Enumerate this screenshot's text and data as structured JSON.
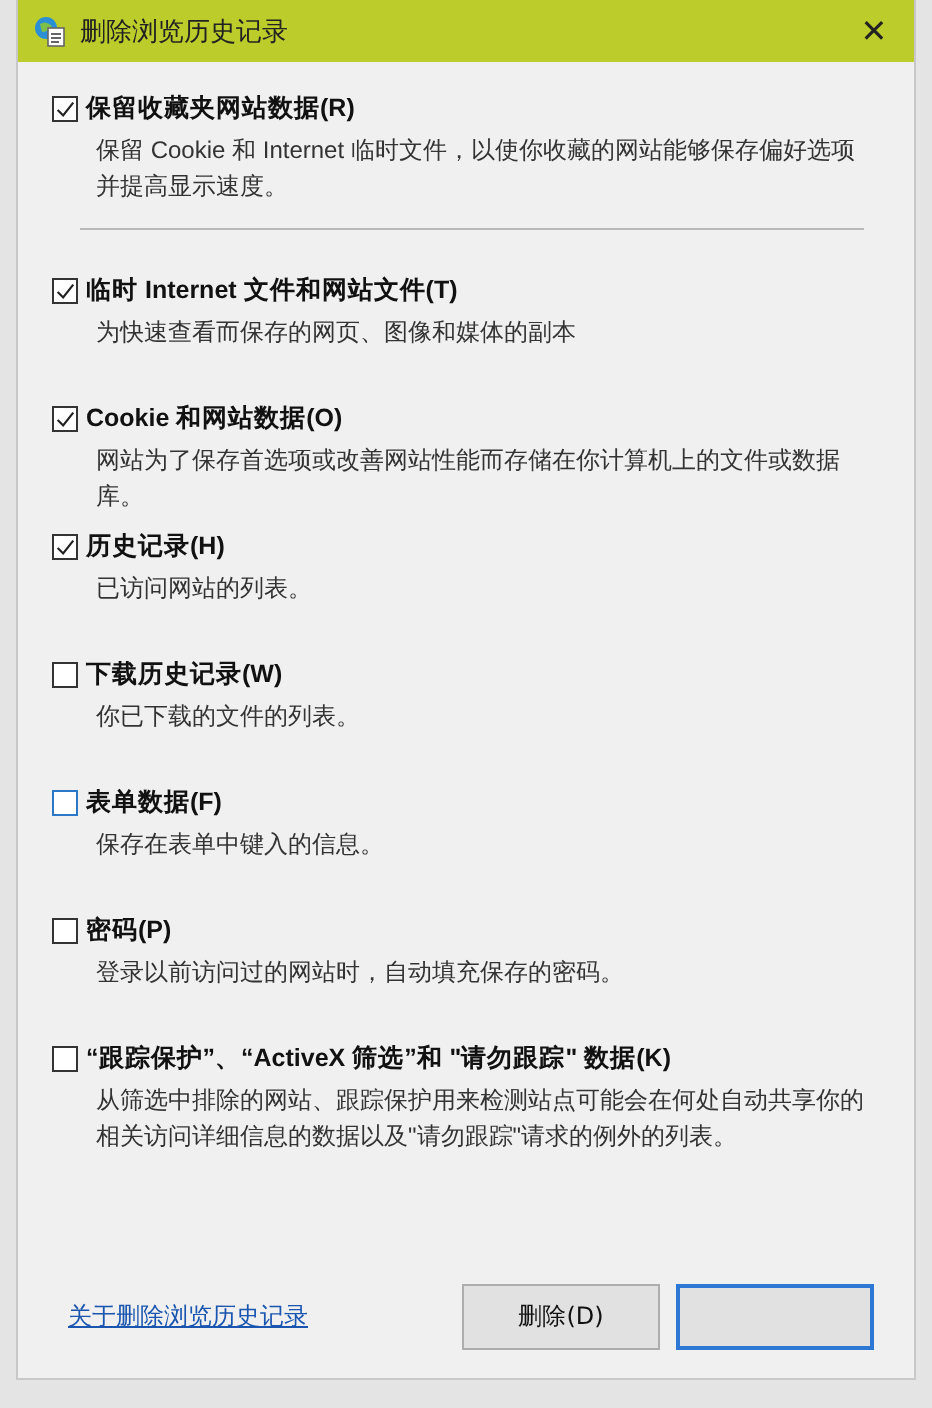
{
  "window": {
    "title": "删除浏览历史记录",
    "close": "✕"
  },
  "top_option": {
    "label": "保留收藏夹网站数据(R)",
    "description": "保留 Cookie 和 Internet 临时文件，以使你收藏的网站能够保存偏好选项并提高显示速度。",
    "checked": true,
    "hovered": false
  },
  "options": [
    {
      "label": "临时 Internet 文件和网站文件(T)",
      "description": "为快速查看而保存的网页、图像和媒体的副本",
      "checked": true,
      "hovered": false
    },
    {
      "label": "Cookie 和网站数据(O)",
      "description": "网站为了保存首选项或改善网站性能而存储在你计算机上的文件或数据库。",
      "checked": true,
      "hovered": false
    },
    {
      "label": "历史记录(H)",
      "description": "已访问网站的列表。",
      "checked": true,
      "hovered": false
    },
    {
      "label": "下载历史记录(W)",
      "description": "你已下载的文件的列表。",
      "checked": false,
      "hovered": false
    },
    {
      "label": "表单数据(F)",
      "description": "保存在表单中键入的信息。",
      "checked": false,
      "hovered": true
    },
    {
      "label": "密码(P)",
      "description": "登录以前访问过的网站时，自动填充保存的密码。",
      "checked": false,
      "hovered": false
    },
    {
      "label": "“跟踪保护”、“ActiveX 筛选”和 \"请勿跟踪\" 数据(K)",
      "description": "从筛选中排除的网站、跟踪保护用来检测站点可能会在何处自动共享你的相关访问详细信息的数据以及\"请勿跟踪\"请求的例外的列表。",
      "checked": false,
      "hovered": false
    }
  ],
  "footer": {
    "link": "关于删除浏览历史记录",
    "buttons": [
      {
        "label": "删除(D)",
        "default": false
      },
      {
        "default": true
      }
    ]
  }
}
